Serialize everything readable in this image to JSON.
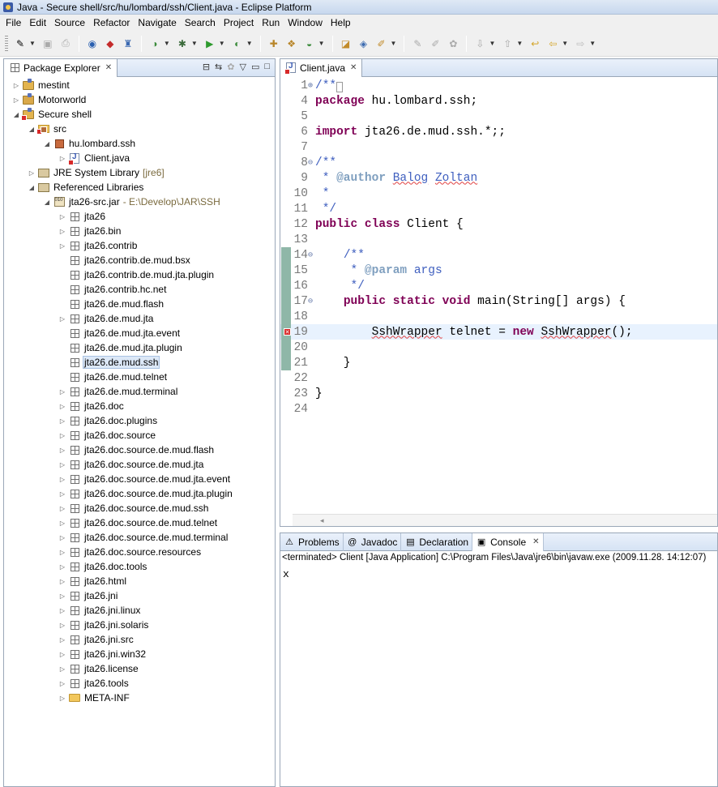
{
  "window": {
    "title": "Java - Secure shell/src/hu/lombard/ssh/Client.java - Eclipse Platform"
  },
  "menubar": [
    "File",
    "Edit",
    "Source",
    "Refactor",
    "Navigate",
    "Search",
    "Project",
    "Run",
    "Window",
    "Help"
  ],
  "explorer": {
    "tab_label": "Package Explorer",
    "tree": [
      {
        "label": "mestint",
        "icon": "project-icon",
        "indent": 0,
        "twisty": "▷"
      },
      {
        "label": "Motorworld",
        "icon": "project-icon",
        "indent": 0,
        "twisty": "▷"
      },
      {
        "label": "Secure shell",
        "icon": "project-icon",
        "indent": 0,
        "twisty": "◢"
      },
      {
        "label": "src",
        "icon": "source-folder-icon",
        "indent": 1,
        "twisty": "◢"
      },
      {
        "label": "hu.lombard.ssh",
        "icon": "package-error-icon",
        "indent": 2,
        "twisty": "◢"
      },
      {
        "label": "Client.java",
        "icon": "java-file-icon",
        "indent": 3,
        "twisty": "▷"
      },
      {
        "label": "JRE System Library",
        "sublabel": "[jre6]",
        "icon": "library-icon",
        "indent": 1,
        "twisty": "▷"
      },
      {
        "label": "Referenced Libraries",
        "icon": "library-icon",
        "indent": 1,
        "twisty": "◢"
      },
      {
        "label": "jta26-src.jar",
        "sublabel": "- E:\\Develop\\JAR\\SSH",
        "icon": "jar-icon",
        "indent": 2,
        "twisty": "◢"
      },
      {
        "label": "jta26",
        "icon": "package-icon",
        "indent": 3,
        "twisty": "▷"
      },
      {
        "label": "jta26.bin",
        "icon": "package-icon",
        "indent": 3,
        "twisty": "▷"
      },
      {
        "label": "jta26.contrib",
        "icon": "package-icon",
        "indent": 3,
        "twisty": "▷"
      },
      {
        "label": "jta26.contrib.de.mud.bsx",
        "icon": "package-icon",
        "indent": 3,
        "twisty": ""
      },
      {
        "label": "jta26.contrib.de.mud.jta.plugin",
        "icon": "package-icon",
        "indent": 3,
        "twisty": ""
      },
      {
        "label": "jta26.contrib.hc.net",
        "icon": "package-icon",
        "indent": 3,
        "twisty": ""
      },
      {
        "label": "jta26.de.mud.flash",
        "icon": "package-icon",
        "indent": 3,
        "twisty": ""
      },
      {
        "label": "jta26.de.mud.jta",
        "icon": "package-icon",
        "indent": 3,
        "twisty": "▷"
      },
      {
        "label": "jta26.de.mud.jta.event",
        "icon": "package-icon",
        "indent": 3,
        "twisty": ""
      },
      {
        "label": "jta26.de.mud.jta.plugin",
        "icon": "package-icon",
        "indent": 3,
        "twisty": ""
      },
      {
        "label": "jta26.de.mud.ssh",
        "icon": "package-icon",
        "indent": 3,
        "twisty": "",
        "selected": true
      },
      {
        "label": "jta26.de.mud.telnet",
        "icon": "package-icon",
        "indent": 3,
        "twisty": ""
      },
      {
        "label": "jta26.de.mud.terminal",
        "icon": "package-icon",
        "indent": 3,
        "twisty": "▷"
      },
      {
        "label": "jta26.doc",
        "icon": "package-icon",
        "indent": 3,
        "twisty": "▷"
      },
      {
        "label": "jta26.doc.plugins",
        "icon": "package-icon",
        "indent": 3,
        "twisty": "▷"
      },
      {
        "label": "jta26.doc.source",
        "icon": "package-icon",
        "indent": 3,
        "twisty": "▷"
      },
      {
        "label": "jta26.doc.source.de.mud.flash",
        "icon": "package-icon",
        "indent": 3,
        "twisty": "▷"
      },
      {
        "label": "jta26.doc.source.de.mud.jta",
        "icon": "package-icon",
        "indent": 3,
        "twisty": "▷"
      },
      {
        "label": "jta26.doc.source.de.mud.jta.event",
        "icon": "package-icon",
        "indent": 3,
        "twisty": "▷"
      },
      {
        "label": "jta26.doc.source.de.mud.jta.plugin",
        "icon": "package-icon",
        "indent": 3,
        "twisty": "▷"
      },
      {
        "label": "jta26.doc.source.de.mud.ssh",
        "icon": "package-icon",
        "indent": 3,
        "twisty": "▷"
      },
      {
        "label": "jta26.doc.source.de.mud.telnet",
        "icon": "package-icon",
        "indent": 3,
        "twisty": "▷"
      },
      {
        "label": "jta26.doc.source.de.mud.terminal",
        "icon": "package-icon",
        "indent": 3,
        "twisty": "▷"
      },
      {
        "label": "jta26.doc.source.resources",
        "icon": "package-icon",
        "indent": 3,
        "twisty": "▷"
      },
      {
        "label": "jta26.doc.tools",
        "icon": "package-icon",
        "indent": 3,
        "twisty": "▷"
      },
      {
        "label": "jta26.html",
        "icon": "package-icon",
        "indent": 3,
        "twisty": "▷"
      },
      {
        "label": "jta26.jni",
        "icon": "package-icon",
        "indent": 3,
        "twisty": "▷"
      },
      {
        "label": "jta26.jni.linux",
        "icon": "package-icon",
        "indent": 3,
        "twisty": "▷"
      },
      {
        "label": "jta26.jni.solaris",
        "icon": "package-icon",
        "indent": 3,
        "twisty": "▷"
      },
      {
        "label": "jta26.jni.src",
        "icon": "package-icon",
        "indent": 3,
        "twisty": "▷"
      },
      {
        "label": "jta26.jni.win32",
        "icon": "package-icon",
        "indent": 3,
        "twisty": "▷"
      },
      {
        "label": "jta26.license",
        "icon": "package-icon",
        "indent": 3,
        "twisty": "▷"
      },
      {
        "label": "jta26.tools",
        "icon": "package-icon",
        "indent": 3,
        "twisty": "▷"
      },
      {
        "label": "META-INF",
        "icon": "folder-icon",
        "indent": 3,
        "twisty": "▷"
      }
    ]
  },
  "editor": {
    "tab_label": "Client.java",
    "lines": [
      {
        "no": "1",
        "fold": "⊕",
        "html": "<span class=\"cm\">/**</span><span class=\"cm\" style=\"border:1px solid #999;font-size:10px;\">&nbsp;</span>"
      },
      {
        "no": "4",
        "html": "<span class=\"kw\">package</span> hu.lombard.ssh;"
      },
      {
        "no": "5",
        "html": ""
      },
      {
        "no": "6",
        "html": "<span class=\"kw\">import</span> jta26.de.mud.ssh.*;;"
      },
      {
        "no": "7",
        "html": ""
      },
      {
        "no": "8",
        "fold": "⊖",
        "html": "<span class=\"cm\">/**</span>"
      },
      {
        "no": "9",
        "html": "<span class=\"cm\"> * </span><span class=\"tag\">@author</span><span class=\"cm\"> <span class=\"squig\">Balog</span> <span class=\"squig\">Zoltan</span></span>"
      },
      {
        "no": "10",
        "html": "<span class=\"cm\"> *</span>"
      },
      {
        "no": "11",
        "html": "<span class=\"cm\"> */</span>"
      },
      {
        "no": "12",
        "html": "<span class=\"kw\">public</span> <span class=\"kw\">class</span> Client {"
      },
      {
        "no": "13",
        "html": ""
      },
      {
        "no": "14",
        "fold": "⊖",
        "changed": true,
        "html": "    <span class=\"cm\">/**</span>"
      },
      {
        "no": "15",
        "changed": true,
        "html": "<span class=\"cm\">     * </span><span class=\"tag\">@param</span><span class=\"cm\"> args</span>"
      },
      {
        "no": "16",
        "changed": true,
        "html": "<span class=\"cm\">     */</span>"
      },
      {
        "no": "17",
        "fold": "⊖",
        "changed": true,
        "html": "    <span class=\"kw\">public</span> <span class=\"kw\">static</span> <span class=\"kw\">void</span> main(String[] args) {"
      },
      {
        "no": "18",
        "changed": true,
        "html": ""
      },
      {
        "no": "19",
        "changed": true,
        "error": true,
        "current": true,
        "html": "        <span class=\"squig\">SshWrapper</span> telnet = <span class=\"kw\">new</span> <span class=\"squig\">SshWrapper</span>();"
      },
      {
        "no": "20",
        "changed": true,
        "html": ""
      },
      {
        "no": "21",
        "changed": true,
        "html": "    }"
      },
      {
        "no": "22",
        "html": ""
      },
      {
        "no": "23",
        "html": "}"
      },
      {
        "no": "24",
        "html": ""
      }
    ]
  },
  "bottom": {
    "tabs": [
      {
        "label": "Problems",
        "icon": "problems-icon",
        "glyph": "⚠"
      },
      {
        "label": "Javadoc",
        "icon": "javadoc-icon",
        "glyph": "@"
      },
      {
        "label": "Declaration",
        "icon": "declaration-icon",
        "glyph": "▤"
      },
      {
        "label": "Console",
        "icon": "console-icon",
        "glyph": "▣",
        "active": true
      }
    ],
    "console_status": "<terminated> Client [Java Application] C:\\Program Files\\Java\\jre6\\bin\\javaw.exe (2009.11.28. 14:12:07)",
    "console_output": "x"
  },
  "colors": {
    "keyword": "#7f0055",
    "comment": "#3f5fbf",
    "javadoc_tag": "#7f9fbf",
    "selection": "#dce8f7",
    "change_bar": "#8fb7a8",
    "error": "#d72a2a"
  }
}
